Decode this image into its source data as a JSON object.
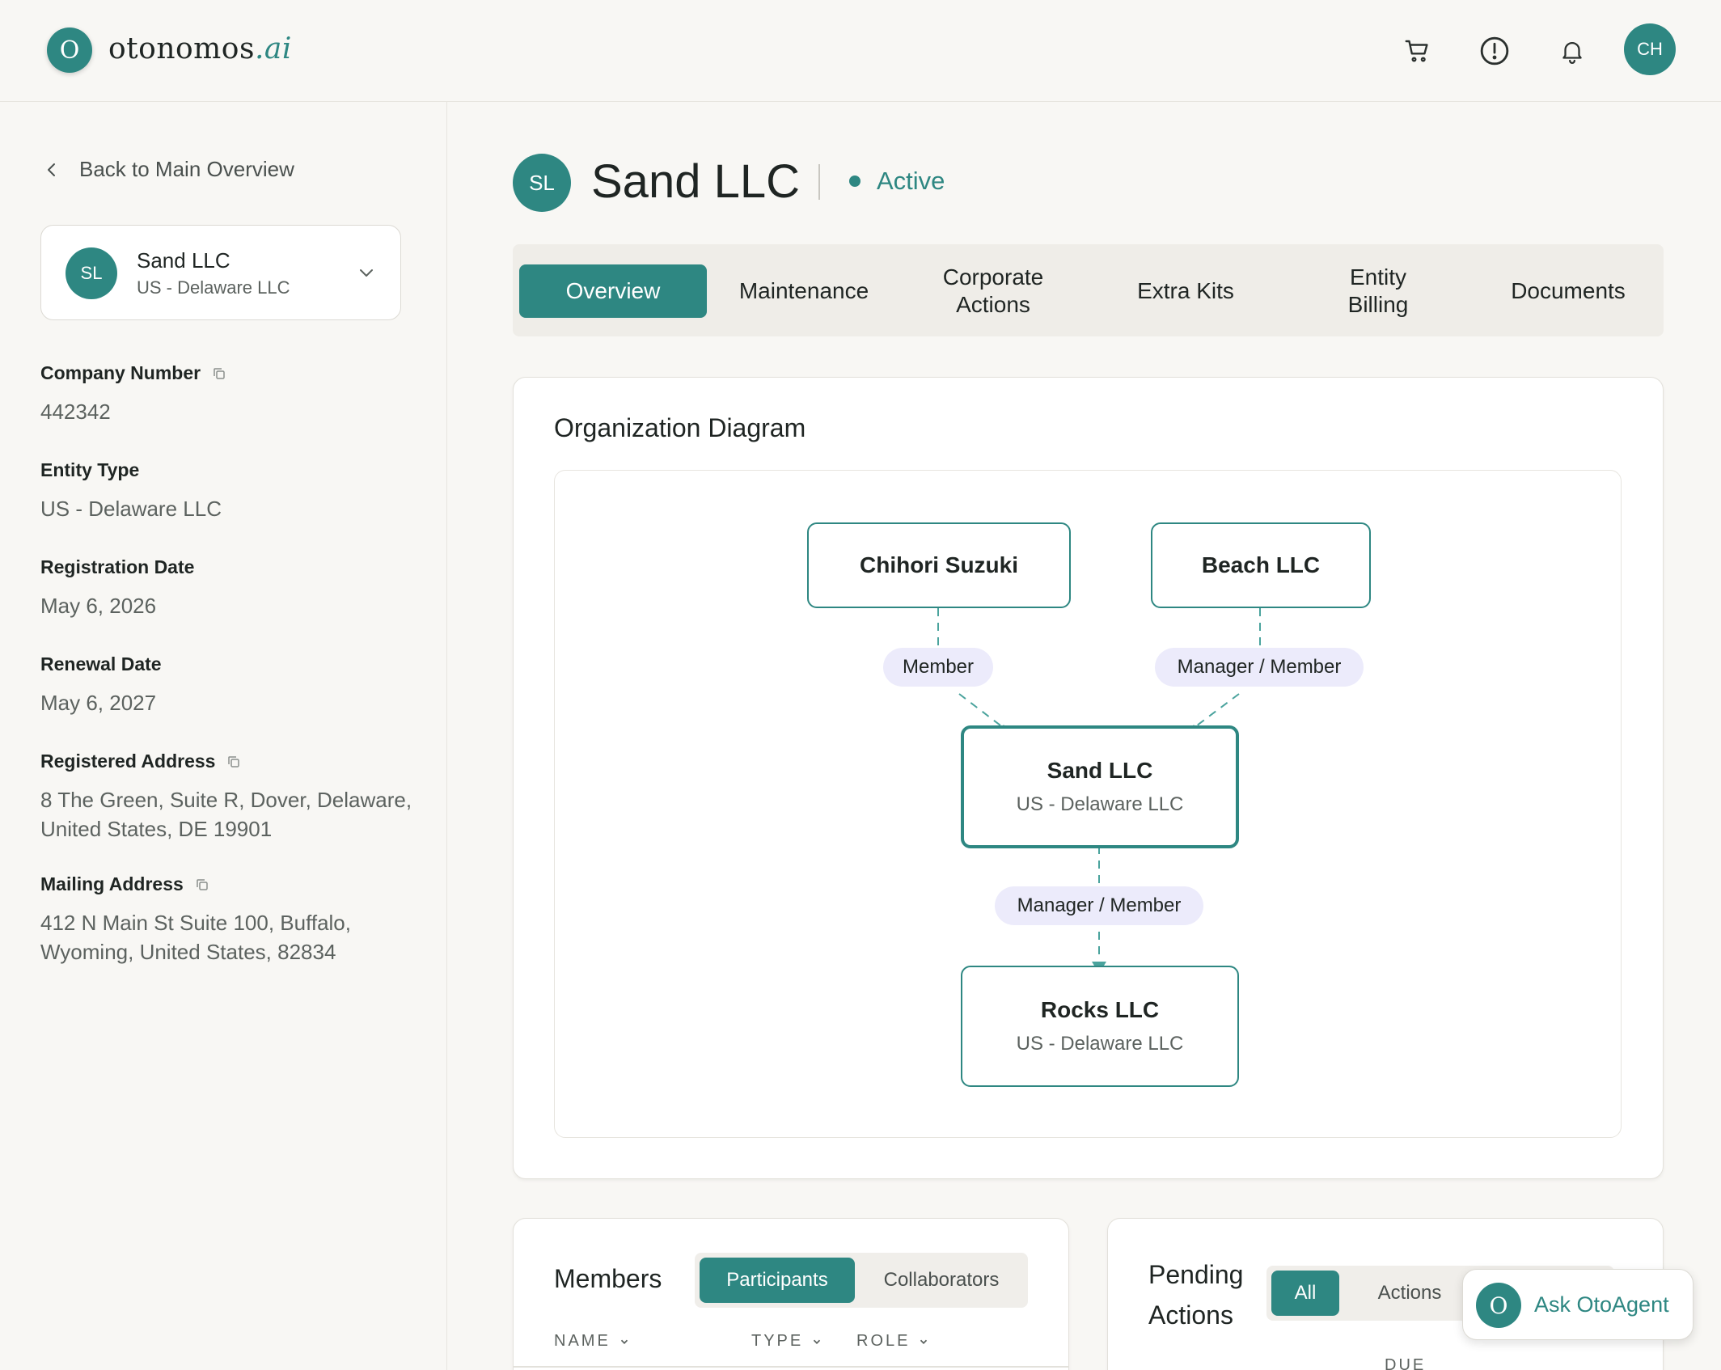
{
  "brand": {
    "mark": "O",
    "name": "otonomos",
    "suffix": ".ai"
  },
  "header": {
    "icons": [
      "cart-icon",
      "alert-icon",
      "bell-icon"
    ],
    "user_initials": "CH"
  },
  "sidebar": {
    "back_label": "Back to Main Overview",
    "entity": {
      "initials": "SL",
      "name": "Sand LLC",
      "type": "US - Delaware LLC"
    },
    "fields": {
      "company_number": {
        "label": "Company Number",
        "value": "442342"
      },
      "entity_type": {
        "label": "Entity Type",
        "value": "US - Delaware LLC"
      },
      "registration_date": {
        "label": "Registration Date",
        "value": "May 6, 2026"
      },
      "renewal_date": {
        "label": "Renewal Date",
        "value": "May 6, 2027"
      },
      "registered_address": {
        "label": "Registered Address",
        "line1": "8 The Green, Suite R, Dover, Delaware,",
        "line2": "United States, DE 19901"
      },
      "mailing_address": {
        "label": "Mailing Address",
        "line1": "412 N Main St Suite 100, Buffalo,",
        "line2": "Wyoming, United States, 82834"
      }
    }
  },
  "page": {
    "initials": "SL",
    "title": "Sand LLC",
    "status": "Active",
    "status_color": "#2e8782"
  },
  "tabs": [
    {
      "label": "Overview",
      "active": true
    },
    {
      "label": "Maintenance"
    },
    {
      "line1": "Corporate",
      "line2": "Actions"
    },
    {
      "label": "Extra Kits"
    },
    {
      "line1": "Entity",
      "line2": "Billing"
    },
    {
      "label": "Documents"
    }
  ],
  "org_diagram": {
    "title": "Organization Diagram",
    "nodes": {
      "chihori": {
        "name": "Chihori Suzuki"
      },
      "beach": {
        "name": "Beach LLC"
      },
      "sand": {
        "name": "Sand LLC",
        "type": "US - Delaware LLC"
      },
      "rocks": {
        "name": "Rocks LLC",
        "type": "US - Delaware LLC"
      }
    },
    "edges": {
      "chihori_sand": "Member",
      "beach_sand": "Manager / Member",
      "sand_rocks": "Manager / Member"
    }
  },
  "members": {
    "title": "Members",
    "segments": [
      "Participants",
      "Collaborators"
    ],
    "active_segment": "Participants",
    "columns": [
      "NAME",
      "TYPE",
      "ROLE"
    ]
  },
  "pending": {
    "title_line1": "Pending",
    "title_line2": "Actions",
    "segments": [
      "All",
      "Actions"
    ],
    "active_segment": "All",
    "columns": [
      "DUE"
    ]
  },
  "agent": {
    "label": "Ask OtoAgent"
  },
  "colors": {
    "accent": "#2e8782",
    "pill": "#ecebfb",
    "background": "#f8f7f4"
  }
}
